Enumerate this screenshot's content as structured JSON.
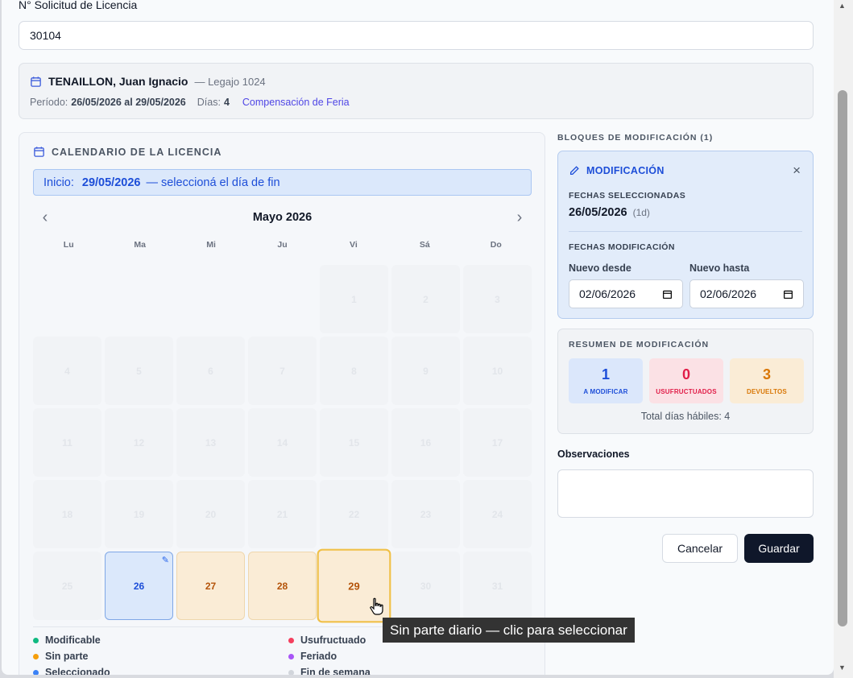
{
  "form": {
    "solicitud_label": "N° Solicitud de Licencia",
    "solicitud_value": "30104"
  },
  "person": {
    "name": "TENAILLON, Juan Ignacio",
    "legajo": "— Legajo 1024",
    "periodo_label": "Período:",
    "periodo_value": "26/05/2026 al 29/05/2026",
    "dias_label": "Días:",
    "dias_value": "4",
    "tipo": "Compensación de Feria"
  },
  "calendar": {
    "title": "CALENDARIO DE LA LICENCIA",
    "inicio_label": "Inicio:",
    "inicio_date": "29/05/2026",
    "inicio_hint": "— seleccioná el día de fin",
    "month": "Mayo 2026",
    "prev_icon": "chevron-left-icon",
    "next_icon": "chevron-right-icon",
    "weekdays": [
      "Lu",
      "Ma",
      "Mi",
      "Ju",
      "Vi",
      "Sá",
      "Do"
    ],
    "days": [
      {
        "d": "",
        "s": "blank"
      },
      {
        "d": "",
        "s": "blank"
      },
      {
        "d": "",
        "s": "blank"
      },
      {
        "d": "",
        "s": "blank"
      },
      {
        "d": "1",
        "s": "dim"
      },
      {
        "d": "2",
        "s": "dim"
      },
      {
        "d": "3",
        "s": "dim"
      },
      {
        "d": "4",
        "s": "dim"
      },
      {
        "d": "5",
        "s": "dim"
      },
      {
        "d": "6",
        "s": "dim"
      },
      {
        "d": "7",
        "s": "dim"
      },
      {
        "d": "8",
        "s": "dim"
      },
      {
        "d": "9",
        "s": "dim"
      },
      {
        "d": "10",
        "s": "dim"
      },
      {
        "d": "11",
        "s": "dim"
      },
      {
        "d": "12",
        "s": "dim"
      },
      {
        "d": "13",
        "s": "dim"
      },
      {
        "d": "14",
        "s": "dim"
      },
      {
        "d": "15",
        "s": "dim"
      },
      {
        "d": "16",
        "s": "dim"
      },
      {
        "d": "17",
        "s": "dim"
      },
      {
        "d": "18",
        "s": "dim"
      },
      {
        "d": "19",
        "s": "dim"
      },
      {
        "d": "20",
        "s": "dim"
      },
      {
        "d": "21",
        "s": "dim"
      },
      {
        "d": "22",
        "s": "dim"
      },
      {
        "d": "23",
        "s": "dim"
      },
      {
        "d": "24",
        "s": "dim"
      },
      {
        "d": "25",
        "s": "dim"
      },
      {
        "d": "26",
        "s": "sel"
      },
      {
        "d": "27",
        "s": "pend"
      },
      {
        "d": "28",
        "s": "pend"
      },
      {
        "d": "29",
        "s": "hover"
      },
      {
        "d": "30",
        "s": "dim"
      },
      {
        "d": "31",
        "s": "dim"
      }
    ],
    "legend": [
      {
        "label": "Modificable",
        "color": "#10b981"
      },
      {
        "label": "Usufructuado",
        "color": "#f43f5e"
      },
      {
        "label": "Sin parte",
        "color": "#f59e0b"
      },
      {
        "label": "Feriado",
        "color": "#a855f7"
      },
      {
        "label": "Seleccionado",
        "color": "#3b82f6"
      },
      {
        "label": "Fin de semana",
        "color": "#d1d5db"
      }
    ]
  },
  "blocks": {
    "title": "BLOQUES DE MODIFICACIÓN (1)",
    "block": {
      "header": "MODIFICACIÓN",
      "fechas_sel_label": "FECHAS SELECCIONADAS",
      "fechas_sel_value": "26/05/2026",
      "fechas_sel_count": "(1d)",
      "fechas_mod_label": "FECHAS MODIFICACIÓN",
      "desde_label": "Nuevo desde",
      "desde_value": "02/06/2026",
      "hasta_label": "Nuevo hasta",
      "hasta_value": "02/06/2026"
    }
  },
  "summary": {
    "title": "RESUMEN DE MODIFICACIÓN",
    "stats": [
      {
        "num": "1",
        "cap": "A MODIFICAR",
        "color": "#1d4ed8"
      },
      {
        "num": "0",
        "cap": "USUFRUCTUADOS",
        "color": "#e11d48"
      },
      {
        "num": "3",
        "cap": "DEVUELTOS",
        "color": "#d97706"
      }
    ],
    "total": "Total días hábiles: 4"
  },
  "observaciones": {
    "label": "Observaciones",
    "value": ""
  },
  "actions": {
    "cancel": "Cancelar",
    "save": "Guardar"
  },
  "tooltip": "Sin parte diario — clic para seleccionar"
}
